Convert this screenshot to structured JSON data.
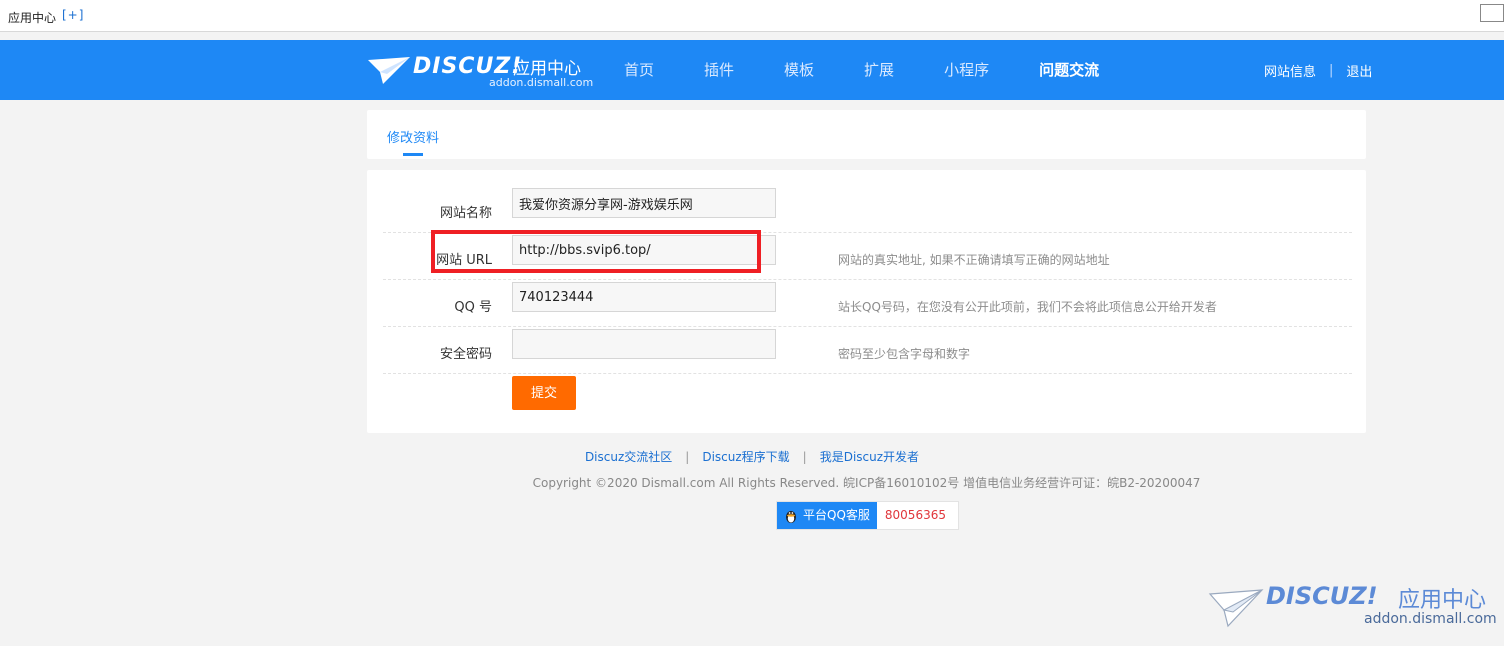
{
  "topbar": {
    "title": "应用中心",
    "add_label": "[+]"
  },
  "header": {
    "logo_word": "DISCUZ!",
    "logo_cn": "应用中心",
    "logo_domain": "addon.dismall.com",
    "nav": [
      {
        "label": "首页"
      },
      {
        "label": "插件"
      },
      {
        "label": "模板"
      },
      {
        "label": "扩展"
      },
      {
        "label": "小程序"
      },
      {
        "label": "问题交流"
      }
    ],
    "site_info": "网站信息",
    "separator": "|",
    "logout": "退出"
  },
  "tabs": {
    "active": "修改资料"
  },
  "form": {
    "rows": [
      {
        "label": "网站名称",
        "value": "我爱你资源分享网-游戏娱乐网",
        "hint": ""
      },
      {
        "label": "网站 URL",
        "value": "http://bbs.svip6.top/",
        "hint": "网站的真实地址, 如果不正确请填写正确的网站地址"
      },
      {
        "label": "QQ 号",
        "value": "740123444",
        "hint": "站长QQ号码，在您没有公开此项前，我们不会将此项信息公开给开发者"
      },
      {
        "label": "安全密码",
        "value": "",
        "hint": "密码至少包含字母和数字"
      }
    ],
    "submit": "提交",
    "highlight_color": "#ef1f24"
  },
  "footer": {
    "links": [
      "Discuz交流社区",
      "Discuz程序下载",
      "我是Discuz开发者"
    ],
    "separator": "|",
    "copyright": "Copyright ©2020 Dismall.com All Rights Reserved. 皖ICP备16010102号 增值电信业务经营许可证：皖B2-20200047",
    "qq_label": "平台QQ客服",
    "qq_number": "80056365"
  },
  "watermark": {
    "word": "DISCUZ!",
    "cn": "应用中心",
    "domain": "addon.dismall.com"
  },
  "colors": {
    "brand": "#1e88f5",
    "submit": "#ff6a00"
  }
}
